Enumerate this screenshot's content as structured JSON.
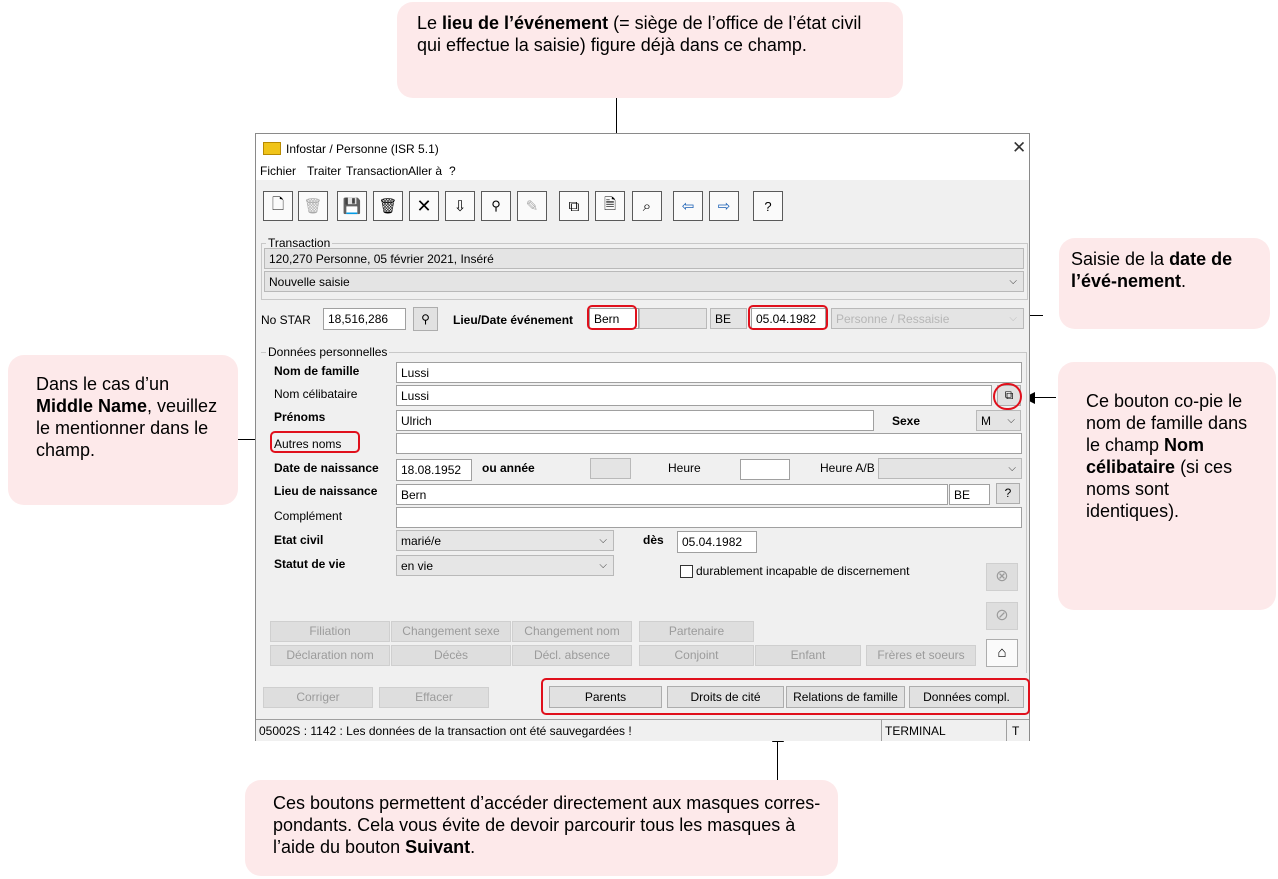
{
  "callouts": {
    "top": {
      "pre": "Le ",
      "bold": "lieu de l’événement",
      "post": " (= siège de l’office de l’état civil qui effectue la saisie) figure déjà dans ce champ."
    },
    "right_top": {
      "pre": "Saisie de la ",
      "bold": "date de l’évé-nement",
      "post": "."
    },
    "left": {
      "pre": "Dans le cas d’un ",
      "bold": "Middle Name",
      "post": ", veuillez le mentionner dans le champ."
    },
    "right_mid": {
      "pre": "Ce bouton co-pie le nom de famille dans le champ ",
      "bold": "Nom célibataire",
      "post": " (si ces noms sont identiques)."
    },
    "bottom": {
      "pre": "Ces boutons permettent d’accéder directement aux masques corres-pondants. Cela vous évite de devoir parcourir tous les masques à l’aide du bouton ",
      "bold": "Suivant",
      "post": "."
    }
  },
  "window": {
    "title": "Infostar / Personne (ISR 5.1)",
    "menu": [
      "Fichier",
      "Traiter",
      "Transaction",
      "Aller à",
      "?"
    ],
    "toolbar_icons": [
      "new-icon",
      "trash-disabled-icon",
      "save-icon",
      "delete-icon",
      "cancel-icon",
      "filter-icon",
      "binoculars-icon",
      "edit-disabled-icon",
      "copy-icon",
      "document-icon",
      "search-doc-icon",
      "back-arrow-icon",
      "forward-arrow-icon",
      "help-icon"
    ],
    "transaction": {
      "group_label": "Transaction",
      "info": "120,270  Personne, 05 février 2021, Inséré",
      "mode": "Nouvelle saisie"
    },
    "star": {
      "label": "No STAR",
      "value": "18,516,286",
      "event_label": "Lieu/Date événement",
      "place": "Bern",
      "canton": "BE",
      "date": "05.04.1982",
      "ghost_select": "Personne / Ressaisie"
    },
    "personal": {
      "group_label": "Données personnelles",
      "nom_famille": {
        "label": "Nom de famille",
        "value": "Lussi"
      },
      "nom_celibataire": {
        "label": "Nom célibataire",
        "value": "Lussi"
      },
      "prenoms": {
        "label": "Prénoms",
        "value": "Ulrich"
      },
      "sexe": {
        "label": "Sexe",
        "value": "M"
      },
      "autres_noms": {
        "label": "Autres noms",
        "value": ""
      },
      "date_naissance": {
        "label": "Date de naissance",
        "value": "18.08.1952",
        "ou_annee": "ou année",
        "heure": "Heure",
        "heure_ab": "Heure A/B"
      },
      "lieu_naissance": {
        "label": "Lieu de naissance",
        "value": "Bern",
        "canton": "BE",
        "help": "?"
      },
      "complement": {
        "label": "Complément",
        "value": ""
      },
      "etat_civil": {
        "label": "Etat civil",
        "value": "marié/e",
        "des_label": "dès",
        "des_value": "05.04.1982"
      },
      "statut_vie": {
        "label": "Statut de vie",
        "value": "en vie",
        "checkbox_label": "durablement incapable de discernement"
      }
    },
    "nav_row1": [
      "Filiation",
      "Changement sexe",
      "Changement nom",
      "Partenaire"
    ],
    "nav_row2": [
      "Déclaration nom",
      "Décès",
      "Décl. absence",
      "Conjoint",
      "Enfant",
      "Frères et soeurs"
    ],
    "bottom_buttons": {
      "corriger": "Corriger",
      "effacer": "Effacer",
      "parents": "Parents",
      "droits": "Droits de cité",
      "relations": "Relations de famille",
      "donnees": "Données compl."
    },
    "status": {
      "message": "05002S : 1142 :  Les données de la transaction ont été sauvegardées !",
      "terminal": "TERMINAL",
      "flag": "T"
    }
  }
}
